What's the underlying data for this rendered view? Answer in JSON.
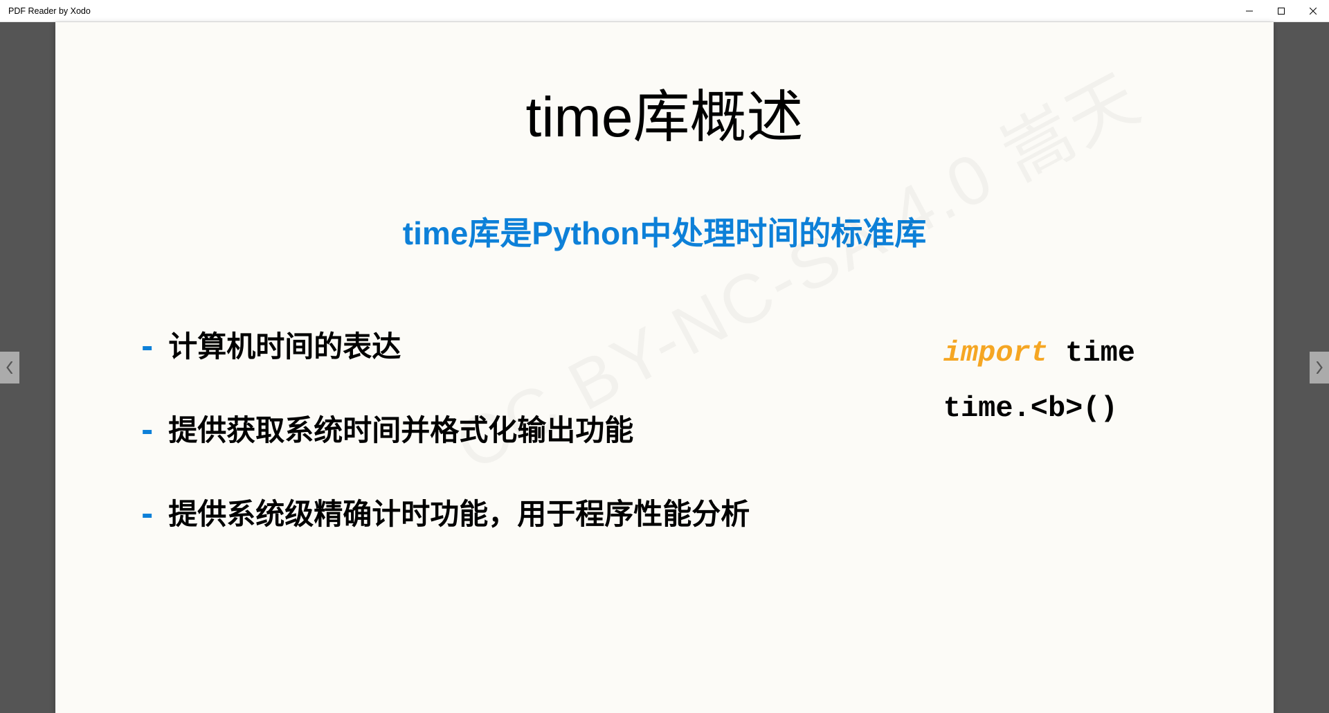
{
  "window": {
    "title": "PDF Reader by Xodo"
  },
  "slide": {
    "title": "time库概述",
    "subtitle": "time库是Python中处理时间的标准库",
    "bullets": [
      "计算机时间的表达",
      "提供获取系统时间并格式化输出功能",
      "提供系统级精确计时功能，用于程序性能分析"
    ],
    "code": {
      "line1_keyword": "import",
      "line1_rest": " time",
      "line2": "time.<b>()"
    },
    "watermark": "CC BY-NC-SA 4.0 嵩天"
  }
}
